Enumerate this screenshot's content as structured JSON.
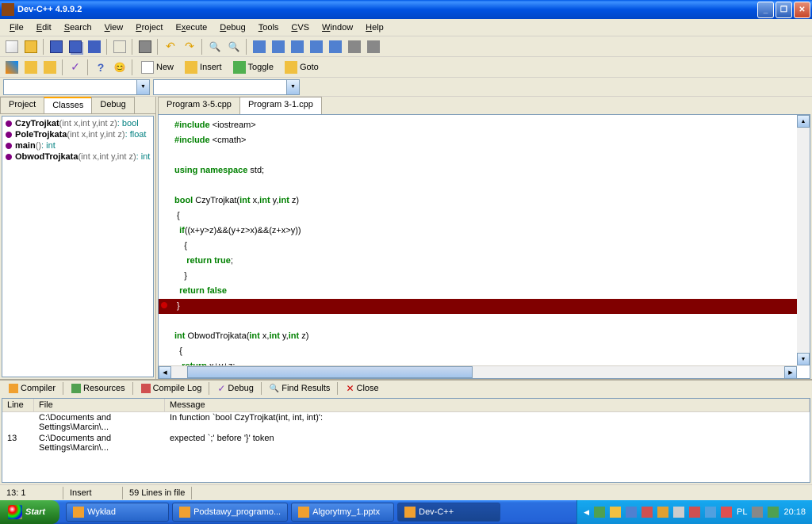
{
  "window": {
    "title": "Dev-C++ 4.9.9.2"
  },
  "menu": {
    "items": [
      "File",
      "Edit",
      "Search",
      "View",
      "Project",
      "Execute",
      "Debug",
      "Tools",
      "CVS",
      "Window",
      "Help"
    ]
  },
  "toolbar2": {
    "new": "New",
    "insert": "Insert",
    "toggle": "Toggle",
    "goto": "Goto"
  },
  "left_tabs": {
    "project": "Project",
    "classes": "Classes",
    "debug": "Debug"
  },
  "classes": [
    {
      "name": "CzyTrojkat",
      "sig": "(int x,int y,int z)",
      "ret": ": bool"
    },
    {
      "name": "PoleTrojkata",
      "sig": "(int x,int y,int z)",
      "ret": ": float"
    },
    {
      "name": "main",
      "sig": "()",
      "ret": ": int"
    },
    {
      "name": "ObwodTrojkata",
      "sig": "(int x,int y,int z)",
      "ret": ": int"
    }
  ],
  "editor_tabs": {
    "tab1": "Program 3-5.cpp",
    "tab2": "Program 3-1.cpp"
  },
  "code_lines": [
    {
      "html": "<span class='kw'>#include</span> &lt;iostream&gt;"
    },
    {
      "html": "<span class='kw'>#include</span> &lt;cmath&gt;"
    },
    {
      "html": ""
    },
    {
      "html": "<span class='kw'>using namespace</span> std;"
    },
    {
      "html": ""
    },
    {
      "html": "<span class='kw'>bool</span> CzyTrojkat(<span class='kw'>int</span> x,<span class='kw'>int</span> y,<span class='kw'>int</span> z)"
    },
    {
      "html": " {"
    },
    {
      "html": "  <span class='kw'>if</span>((x+y&gt;z)&amp;&amp;(y+z&gt;x)&amp;&amp;(z+x&gt;y))"
    },
    {
      "html": "    {"
    },
    {
      "html": "     <span class='kw'>return true</span>;"
    },
    {
      "html": "    }"
    },
    {
      "html": "  <span class='kw'>return false</span>"
    },
    {
      "html": " }",
      "error": true
    },
    {
      "html": ""
    },
    {
      "html": "<span class='kw'>int</span> ObwodTrojkata(<span class='kw'>int</span> x,<span class='kw'>int</span> y,<span class='kw'>int</span> z)"
    },
    {
      "html": "  {"
    },
    {
      "html": "   <span class='kw'>return</span> x+y+z;"
    }
  ],
  "bottom_tabs": {
    "compiler": "Compiler",
    "resources": "Resources",
    "compilelog": "Compile Log",
    "debug": "Debug",
    "findresults": "Find Results",
    "close": "Close"
  },
  "msg_headers": {
    "line": "Line",
    "file": "File",
    "message": "Message"
  },
  "messages": [
    {
      "line": "",
      "file": "C:\\Documents and Settings\\Marcin\\...",
      "message": "In function `bool CzyTrojkat(int, int, int)':"
    },
    {
      "line": "13",
      "file": "C:\\Documents and Settings\\Marcin\\...",
      "message": "expected `;' before '}' token"
    }
  ],
  "statusbar": {
    "pos": "13: 1",
    "mode": "Insert",
    "lines": "59 Lines in file"
  },
  "taskbar": {
    "start": "Start",
    "tasks": [
      {
        "label": "Wykład"
      },
      {
        "label": "Podstawy_programo..."
      },
      {
        "label": "Algorytmy_1.pptx"
      },
      {
        "label": "Dev-C++",
        "active": true
      }
    ],
    "lang": "PL",
    "time": "20:18"
  }
}
